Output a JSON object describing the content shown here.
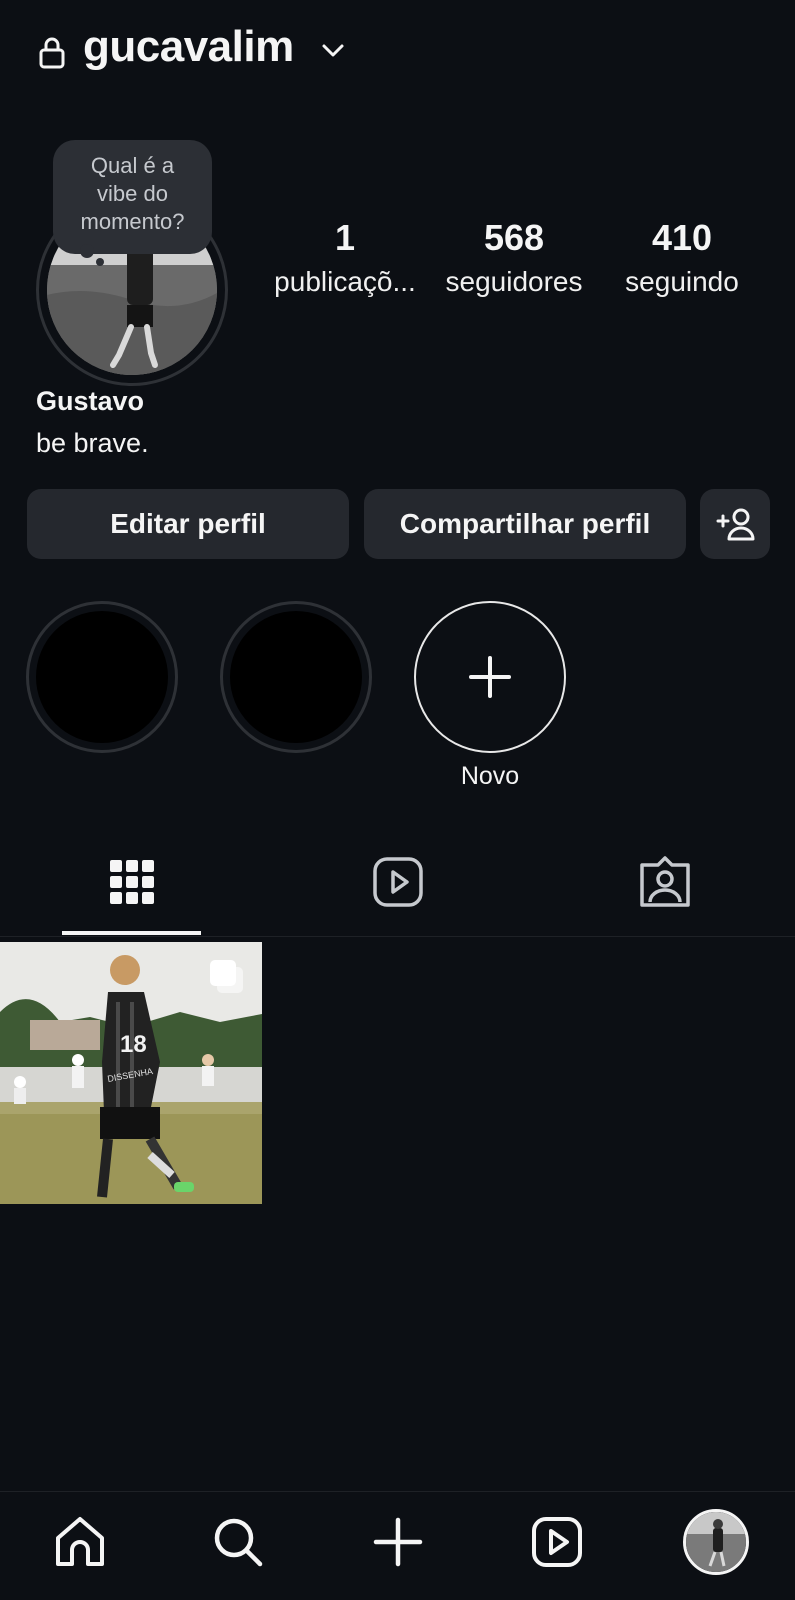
{
  "header": {
    "username": "gucavalim",
    "lock_icon": "lock-icon",
    "switch_icon": "chevron-down-icon"
  },
  "note": {
    "text_line1": "Qual é a",
    "text_line2": "vibe do",
    "text_line3": "momento?"
  },
  "stats": [
    {
      "value": "1",
      "label": "publicaçõ..."
    },
    {
      "value": "568",
      "label": "seguidores"
    },
    {
      "value": "410",
      "label": "seguindo"
    }
  ],
  "profile": {
    "name": "Gustavo",
    "bio": "be brave."
  },
  "buttons": {
    "edit": "Editar perfil",
    "share": "Compartilhar perfil",
    "discover_icon": "add-person-icon"
  },
  "highlights": {
    "new_label": "Novo"
  },
  "tabs": [
    "grid-icon",
    "reels-icon",
    "tagged-icon"
  ],
  "bottom_nav": [
    "home-icon",
    "search-icon",
    "create-icon",
    "reels-icon",
    "profile-avatar"
  ],
  "post_overlay": {
    "jersey_number": "18",
    "jersey_name": "DISSENHA"
  },
  "colors": {
    "background": "#0c0f14",
    "button": "#25282e",
    "text": "#f5f5f5"
  }
}
